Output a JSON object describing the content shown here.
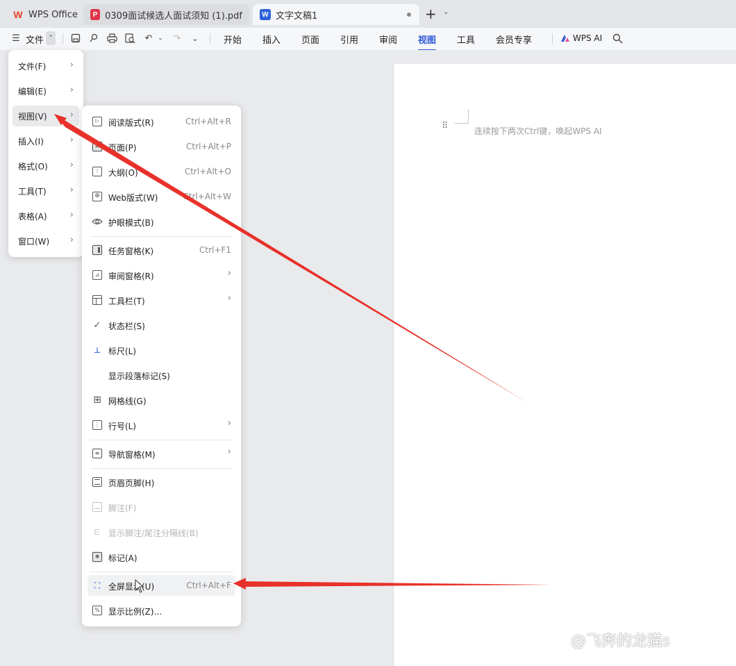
{
  "tabs": [
    {
      "label": "WPS Office",
      "icon": "wps-logo-icon",
      "color": "#e8452c"
    },
    {
      "label": "0309面试候选人面试须知 (1).pdf",
      "icon": "pdf-icon",
      "color": "#e1354a"
    },
    {
      "label": "文字文稿1",
      "icon": "word-doc-icon",
      "color": "#2b63d9"
    }
  ],
  "toolbar": {
    "menu_button_label": "文件",
    "ribbon_tabs": [
      "开始",
      "插入",
      "页面",
      "引用",
      "审阅",
      "视图",
      "工具",
      "会员专享"
    ],
    "active_tab": "视图",
    "wps_ai_label": "WPS AI"
  },
  "document": {
    "placeholder": "连续按下两次Ctrl键，唤起WPS AI"
  },
  "main_menu": {
    "items": [
      {
        "label": "文件(F)"
      },
      {
        "label": "编辑(E)"
      },
      {
        "label": "视图(V)"
      },
      {
        "label": "插入(I)"
      },
      {
        "label": "格式(O)"
      },
      {
        "label": "工具(T)"
      },
      {
        "label": "表格(A)"
      },
      {
        "label": "窗口(W)"
      }
    ],
    "highlighted": "视图(V)"
  },
  "view_menu": {
    "items": [
      {
        "label": "阅读版式(R)",
        "shortcut": "Ctrl+Alt+R",
        "icon": "reading-mode-icon"
      },
      {
        "label": "页面(P)",
        "shortcut": "Ctrl+Alt+P",
        "icon": "page-view-icon"
      },
      {
        "label": "大纲(O)",
        "shortcut": "Ctrl+Alt+O",
        "icon": "outline-icon"
      },
      {
        "label": "Web版式(W)",
        "shortcut": "Ctrl+Alt+W",
        "icon": "web-layout-icon"
      },
      {
        "label": "护眼模式(B)",
        "shortcut": "",
        "icon": "eye-care-icon"
      },
      {
        "label": "任务窗格(K)",
        "shortcut": "Ctrl+F1",
        "icon": "task-pane-icon"
      },
      {
        "label": "审阅窗格(R)",
        "shortcut": "",
        "icon": "review-pane-icon"
      },
      {
        "label": "工具栏(T)",
        "shortcut": "",
        "icon": "toolbar-icon"
      },
      {
        "label": "状态栏(S)",
        "shortcut": "",
        "icon": "check-icon"
      },
      {
        "label": "标尺(L)",
        "shortcut": "",
        "icon": "ruler-icon"
      },
      {
        "label": "显示段落标记(S)",
        "shortcut": "",
        "icon": ""
      },
      {
        "label": "网格线(G)",
        "shortcut": "",
        "icon": "gridlines-icon"
      },
      {
        "label": "行号(L)",
        "shortcut": "",
        "icon": "line-numbers-icon"
      },
      {
        "label": "导航窗格(M)",
        "shortcut": "",
        "icon": "navigation-pane-icon"
      },
      {
        "label": "页眉页脚(H)",
        "shortcut": "",
        "icon": "header-footer-icon"
      },
      {
        "label": "脚注(F)",
        "shortcut": "",
        "icon": "footnote-icon"
      },
      {
        "label": "显示脚注/尾注分隔线(B)",
        "shortcut": "",
        "icon": "footnote-separator-icon"
      },
      {
        "label": "标记(A)",
        "shortcut": "",
        "icon": "markup-icon"
      },
      {
        "label": "全屏显示(U)",
        "shortcut": "Ctrl+Alt+F",
        "icon": "fullscreen-icon"
      },
      {
        "label": "显示比例(Z)...",
        "shortcut": "",
        "icon": "zoom-ratio-icon"
      }
    ],
    "highlighted": "全屏显示(U)"
  },
  "annotation_color": "#e8312a",
  "watermark": "@飞奔的龙猫s"
}
